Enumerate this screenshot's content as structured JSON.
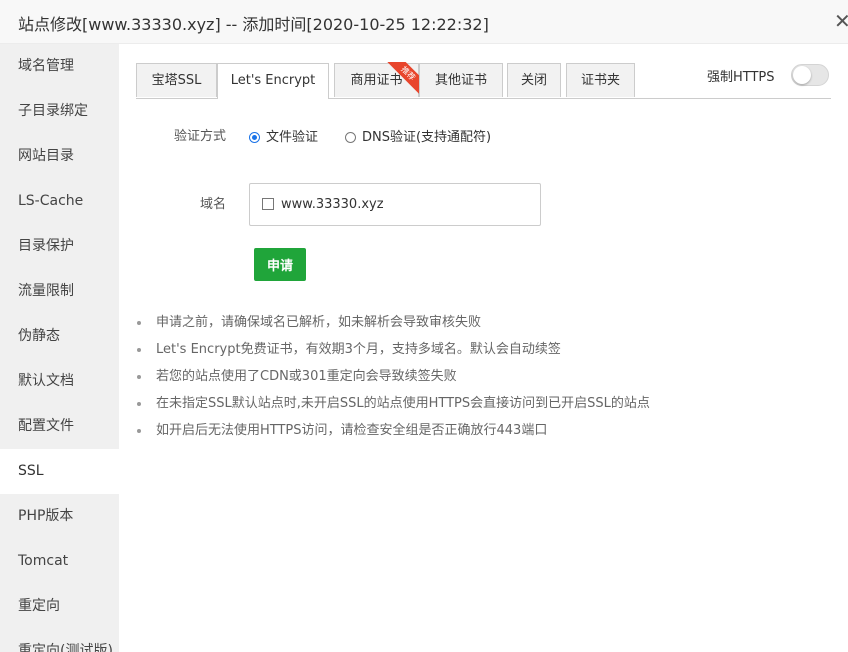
{
  "window": {
    "title": "站点修改[www.33330.xyz] -- 添加时间[2020-10-25 12:22:32]",
    "close_glyph": "✕"
  },
  "sidebar": {
    "items": [
      {
        "label": "域名管理",
        "active": false
      },
      {
        "label": "子目录绑定",
        "active": false
      },
      {
        "label": "网站目录",
        "active": false
      },
      {
        "label": "LS-Cache",
        "active": false
      },
      {
        "label": "目录保护",
        "active": false
      },
      {
        "label": "流量限制",
        "active": false
      },
      {
        "label": "伪静态",
        "active": false
      },
      {
        "label": "默认文档",
        "active": false
      },
      {
        "label": "配置文件",
        "active": false
      },
      {
        "label": "SSL",
        "active": true
      },
      {
        "label": "PHP版本",
        "active": false
      },
      {
        "label": "Tomcat",
        "active": false
      },
      {
        "label": "重定向",
        "active": false
      },
      {
        "label": "重定向(测试版)",
        "active": false
      }
    ]
  },
  "tabs": [
    {
      "label": "宝塔SSL",
      "active": false
    },
    {
      "label": "Let's Encrypt",
      "active": true
    },
    {
      "label": "商用证书",
      "active": false,
      "badge": "推荐"
    },
    {
      "label": "其他证书",
      "active": false
    },
    {
      "label": "关闭",
      "active": false
    },
    {
      "label": "证书夹",
      "active": false
    }
  ],
  "force_https": {
    "label": "强制HTTPS",
    "enabled": false
  },
  "verify": {
    "label": "验证方式",
    "options": [
      {
        "label": "文件验证",
        "checked": true
      },
      {
        "label": "DNS验证(支持通配符)",
        "checked": false
      }
    ]
  },
  "domain": {
    "label": "域名",
    "items": [
      {
        "label": "www.33330.xyz",
        "checked": false
      }
    ]
  },
  "apply_button": {
    "label": "申请"
  },
  "tips": [
    "申请之前，请确保域名已解析，如未解析会导致审核失败",
    "Let's Encrypt免费证书，有效期3个月，支持多域名。默认会自动续签",
    "若您的站点使用了CDN或301重定向会导致续签失败",
    "在未指定SSL默认站点时,未开启SSL的站点使用HTTPS会直接访问到已开启SSL的站点",
    "如开启后无法使用HTTPS访问，请检查安全组是否正确放行443端口"
  ],
  "colors": {
    "primary": "#20a53a",
    "radio_accent": "#1a73e8",
    "badge": "#e8452c"
  }
}
